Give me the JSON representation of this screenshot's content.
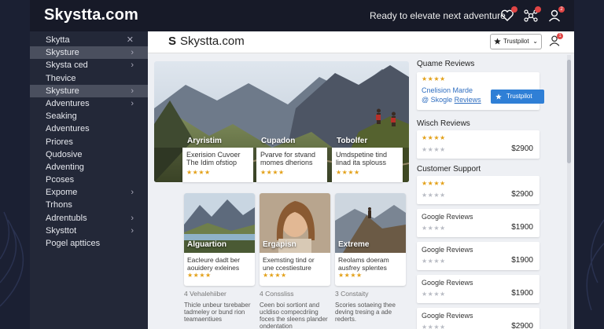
{
  "topbar": {
    "brand": "Skystta.com",
    "tagline": "Ready to elevate next adventure",
    "badges": [
      "",
      "",
      "2"
    ]
  },
  "sidebar": {
    "items": [
      {
        "label": "Skytta",
        "marker": "✕",
        "active": false
      },
      {
        "label": "Skysture",
        "marker": "›",
        "active": true
      },
      {
        "label": "Skysta ced",
        "marker": "›",
        "active": false
      },
      {
        "label": "Thevice",
        "marker": "",
        "active": false
      },
      {
        "label": "Skysture",
        "marker": "›",
        "active": true
      },
      {
        "label": "Adventures",
        "marker": "›",
        "active": false
      },
      {
        "label": "Seaking",
        "marker": "",
        "active": false
      },
      {
        "label": "Adventures",
        "marker": "",
        "active": false
      },
      {
        "label": "Priores",
        "marker": "",
        "active": false
      },
      {
        "label": "Qudosive",
        "marker": "",
        "active": false
      },
      {
        "label": "Adventing",
        "marker": "",
        "active": false
      },
      {
        "label": "Pcoses",
        "marker": "",
        "active": false
      },
      {
        "label": "Expome",
        "marker": "›",
        "active": false
      },
      {
        "label": "Trhons",
        "marker": "",
        "active": false
      },
      {
        "label": "Adrentubls",
        "marker": "›",
        "active": false
      },
      {
        "label": "Skysttot",
        "marker": "›",
        "active": false
      },
      {
        "label": "Pogel apttices",
        "marker": "",
        "active": false
      }
    ]
  },
  "main": {
    "logo_glyph": "S",
    "logo_text": "Skystta.com",
    "selector_label": "Trustpilot",
    "selector_chevron": "⌄",
    "head_badge": "1"
  },
  "hero": {
    "captions": [
      "Aryristim",
      "Cupadon",
      "Tobolfer"
    ],
    "cards": [
      {
        "line1": "Exerision Cuvoer",
        "line2": "The Idim ofstiop",
        "stars": "★★★★"
      },
      {
        "line1": "Pvarve for stvand",
        "line2": "momes dherions",
        "stars": "★★★★"
      },
      {
        "line1": "Umdspetine tind",
        "line2": "linad ita splouss",
        "stars": "★★★★"
      }
    ]
  },
  "cards": [
    {
      "label": "Alguartion",
      "line1": "Eacleure dadt ber",
      "line2": "aouidery exleines",
      "stars": "★★★★"
    },
    {
      "label": "Ergapisn",
      "line1": "Exemsting tind or",
      "line2": "une ccestiesture",
      "stars": "★★★★"
    },
    {
      "label": "Extreme",
      "line1": "Reolams doeram",
      "line2": "ausfrey splentes",
      "stars": "★★★★"
    }
  ],
  "below": [
    {
      "sub": "4 Vehalehiiber",
      "lines": [
        "Thicle unbeur tsrebaber",
        "tadmeley or bund rion",
        "teamaentiues"
      ]
    },
    {
      "sub": "4 Conssliss",
      "lines": [
        "Ceen boi sortiont and",
        "ucldiso compecdriing",
        "foces the sleens plander",
        "ondentation"
      ]
    },
    {
      "sub": "3 Constaity",
      "lines": [
        "Scories sotaeing thee",
        "deving tresing a ade",
        "rederts."
      ]
    }
  ],
  "reviews": {
    "quame_title": "Quame Reviews",
    "quame_stars": "★★★★",
    "quame_line1": "Cnelision Marde",
    "quame_line2_prefix": "@ Skogle",
    "quame_line2_link": "Reviews",
    "trustpilot_button": "Trustpilot",
    "wisch_title": "Wisch Reviews",
    "support_title": "Customer Support",
    "rows": [
      {
        "label": "★★★★",
        "stars": "★★★★",
        "price": "$2900"
      },
      {
        "label": "★★★★",
        "stars": "★★★★",
        "price": "$2900"
      },
      {
        "label": "Google Reviews",
        "stars": "★★★★",
        "price": "$1900"
      },
      {
        "label": "Google Reviews",
        "stars": "★★★★",
        "price": "$1900"
      },
      {
        "label": "Google Reviews",
        "stars": "★★★★",
        "price": "$1900"
      },
      {
        "label": "Google Reviews",
        "stars": "★★★★",
        "price": "$2900"
      }
    ]
  },
  "colors": {
    "accent": "#2f7fd6",
    "star": "#e3a11a",
    "badge": "#e04545",
    "sidebar_bg": "#232838"
  },
  "icons": [
    "heart-icon",
    "network-icon",
    "user-icon",
    "trustpilot-icon",
    "user-icon"
  ]
}
